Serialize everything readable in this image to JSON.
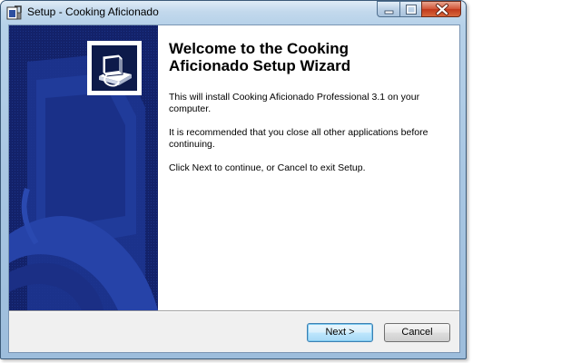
{
  "window": {
    "title": "Setup - Cooking Aficionado",
    "controls": {
      "minimize": "minimize-icon",
      "maximize": "maximize-icon",
      "close": "close-icon"
    }
  },
  "wizard": {
    "heading": "Welcome to the Cooking Aficionado Setup Wizard",
    "paragraphs": [
      "This will install Cooking Aficionado Professional 3.1 on your computer.",
      "It is recommended that you close all other applications before continuing.",
      "Click Next to continue, or Cancel to exit Setup."
    ],
    "image_icon": "setup-install-icon"
  },
  "buttons": {
    "next": "Next >",
    "cancel": "Cancel"
  },
  "colors": {
    "side_panel": "#132266",
    "title_bar": "#b9d3ea",
    "close_button": "#c0391c"
  }
}
